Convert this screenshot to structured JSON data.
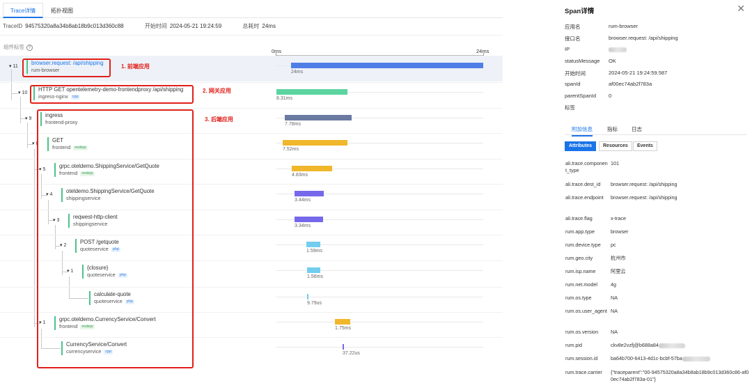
{
  "tabs": [
    "Trace详情",
    "拓扑视图"
  ],
  "meta": {
    "trace_id_label": "TraceID",
    "trace_id": "94575320a8a34b8ab18b9c013d360c88",
    "start_label": "开始时间",
    "start_time": "2024-05-21 19:24:59",
    "total_label": "总耗时",
    "total": "24ms"
  },
  "component_label": "组件标签",
  "axis": {
    "start": "0ms",
    "end": "24ms"
  },
  "spans": [
    {
      "toggle": "▾ 11",
      "name": "browser.request: /api/shipping",
      "service": "rum-browser",
      "tag": "",
      "duration": "24ms"
    },
    {
      "toggle": "▾ 10",
      "name": "HTTP GET opentelemetry-demo-frontendproxy /api/shipping",
      "service": "ingress-nginx",
      "tag": "cpp",
      "duration": "8.31ms"
    },
    {
      "toggle": "▾ 9",
      "name": "ingress",
      "service": "frontend-proxy",
      "tag": "",
      "duration": "7.78ms"
    },
    {
      "toggle": "▾ 8",
      "name": "GET",
      "service": "frontend",
      "tag": "nodejs",
      "duration": "7.52ms"
    },
    {
      "toggle": "▾ 5",
      "name": "grpc.oteldemo.ShippingService/GetQuote",
      "service": "frontend",
      "tag": "nodejs",
      "duration": "4.83ms"
    },
    {
      "toggle": "▾ 4",
      "name": "oteldemo.ShippingService/GetQuote",
      "service": "shippingservice",
      "tag": "",
      "duration": "3.44ms"
    },
    {
      "toggle": "▾ 3",
      "name": "reqwest-http-client",
      "service": "shippingservice",
      "tag": "",
      "duration": "3.34ms"
    },
    {
      "toggle": "▾ 2",
      "name": "POST /getquote",
      "service": "quoteservice",
      "tag": "php",
      "duration": "1.59ms"
    },
    {
      "toggle": "▾ 1",
      "name": "{closure}",
      "service": "quoteservice",
      "tag": "php",
      "duration": "1.56ms"
    },
    {
      "toggle": "",
      "name": "calculate-quote",
      "service": "quoteservice",
      "tag": "php",
      "duration": "9.79us"
    },
    {
      "toggle": "▾ 1",
      "name": "grpc.oteldemo.CurrencyService/Convert",
      "service": "frontend",
      "tag": "nodejs",
      "duration": "1.75ms"
    },
    {
      "toggle": "",
      "name": "CurrencyService/Convert",
      "service": "currencyservice",
      "tag": "cpp",
      "duration": "37.22us"
    }
  ],
  "annotations": [
    "1. 前端应用",
    "2. 网关应用",
    "3. 后端应用"
  ],
  "colors": {
    "accent": "#1a73e8",
    "highlight": "#e0201a",
    "bar_blue": "#4f7fe6",
    "bar_green": "#5cd4a0",
    "bar_slate": "#6a7aa0",
    "bar_yellow": "#f0b72c",
    "bar_purple": "#7668ea",
    "bar_cyan": "#72cdef"
  },
  "detail": {
    "title": "Span详情",
    "close_icon": "close-icon",
    "fields": [
      {
        "k": "应用名",
        "v": "rum-browser"
      },
      {
        "k": "接口名",
        "v": "browser.request: /api/shipping"
      },
      {
        "k": "IP",
        "v": ""
      },
      {
        "k": "statusMessage",
        "v": "OK"
      },
      {
        "k": "开始时间",
        "v": "2024-05-21 19:24:59.587"
      },
      {
        "k": "spanId",
        "v": "af00ec74ab2f783a"
      },
      {
        "k": "parentSpanId",
        "v": "0"
      },
      {
        "k": "标签",
        "v": ""
      }
    ],
    "tabs": [
      "附加信息",
      "指标",
      "日志"
    ],
    "segments": [
      "Attributes",
      "Resources",
      "Events"
    ],
    "attributes": [
      {
        "k": "ali.trace.component_type",
        "v": "101"
      },
      {
        "k": "ali.trace.dest_id",
        "v": "browser.request: /api/shipping"
      },
      {
        "k": "ali.trace.endpoint",
        "v": "browser.request: /api/shipping"
      },
      {
        "k": "ali.trace.flag",
        "v": "x-trace"
      },
      {
        "k": "rum.app.type",
        "v": "browser"
      },
      {
        "k": "rum.device.type",
        "v": "pc"
      },
      {
        "k": "rum.geo.city",
        "v": "杭州市"
      },
      {
        "k": "rum.isp.name",
        "v": "阿里云"
      },
      {
        "k": "rum.net.model",
        "v": "4g"
      },
      {
        "k": "rum.os.type",
        "v": "NA"
      },
      {
        "k": "rum.os.user_agent",
        "v": "NA"
      },
      {
        "k": "rum.os.version",
        "v": "NA"
      },
      {
        "k": "rum.pid",
        "v": "ckv8e2vzfj@b688a84"
      },
      {
        "k": "rum.session.id",
        "v": "ba64b700-6413-4d1c-bcbf-57ba"
      },
      {
        "k": "rum.trace.carrier",
        "v": "{\"traceparent\":\"00-94575320a8a34b8ab18b9c013d360c86-af00ec74ab2f783a-01\"}"
      }
    ]
  }
}
